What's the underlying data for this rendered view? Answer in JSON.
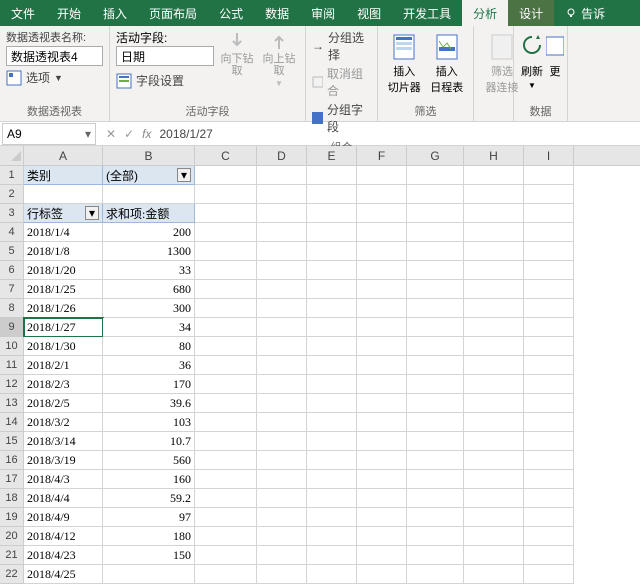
{
  "tabs": {
    "file": "文件",
    "home": "开始",
    "insert": "插入",
    "layout": "页面布局",
    "formula": "公式",
    "data": "数据",
    "review": "审阅",
    "view": "视图",
    "dev": "开发工具",
    "analyze": "分析",
    "design": "设计",
    "tell": "告诉"
  },
  "ribbon": {
    "g1": {
      "label": "数据透视表",
      "nameLbl": "数据透视表名称:",
      "nameVal": "数据透视表4",
      "options": "选项"
    },
    "g2": {
      "label": "活动字段",
      "actLbl": "活动字段:",
      "actVal": "日期",
      "fieldSet": "字段设置",
      "drillDown": "向下钻取",
      "drillUp": "向上钻\n取"
    },
    "g3": {
      "label": "组合",
      "groupSel": "分组选择",
      "ungroup": "取消组合",
      "groupFld": "分组字段"
    },
    "g4": {
      "label": "筛选",
      "slicer": "插入\n切片器",
      "timeline": "插入\n日程表",
      "conn": "筛选\n器连接"
    },
    "g5": {
      "label": "数据",
      "refresh": "刷新",
      "change": "更"
    }
  },
  "namebox": "A9",
  "formula": "2018/1/27",
  "cols": [
    "A",
    "B",
    "C",
    "D",
    "E",
    "F",
    "G",
    "H",
    "I"
  ],
  "pivot": {
    "catLbl": "类别",
    "catVal": "(全部)",
    "rowLbl": "行标签",
    "valLbl": "求和项:金额"
  },
  "rows": [
    {
      "a": "2018/1/4",
      "b": "200"
    },
    {
      "a": "2018/1/8",
      "b": "1300"
    },
    {
      "a": "2018/1/20",
      "b": "33"
    },
    {
      "a": "2018/1/25",
      "b": "680"
    },
    {
      "a": "2018/1/26",
      "b": "300"
    },
    {
      "a": "2018/1/27",
      "b": "34"
    },
    {
      "a": "2018/1/30",
      "b": "80"
    },
    {
      "a": "2018/2/1",
      "b": "36"
    },
    {
      "a": "2018/2/3",
      "b": "170"
    },
    {
      "a": "2018/2/5",
      "b": "39.6"
    },
    {
      "a": "2018/3/2",
      "b": "103"
    },
    {
      "a": "2018/3/14",
      "b": "10.7"
    },
    {
      "a": "2018/3/19",
      "b": "560"
    },
    {
      "a": "2018/4/3",
      "b": "160"
    },
    {
      "a": "2018/4/4",
      "b": "59.2"
    },
    {
      "a": "2018/4/9",
      "b": "97"
    },
    {
      "a": "2018/4/12",
      "b": "180"
    },
    {
      "a": "2018/4/23",
      "b": "150"
    },
    {
      "a": "2018/4/25",
      "b": ""
    }
  ]
}
